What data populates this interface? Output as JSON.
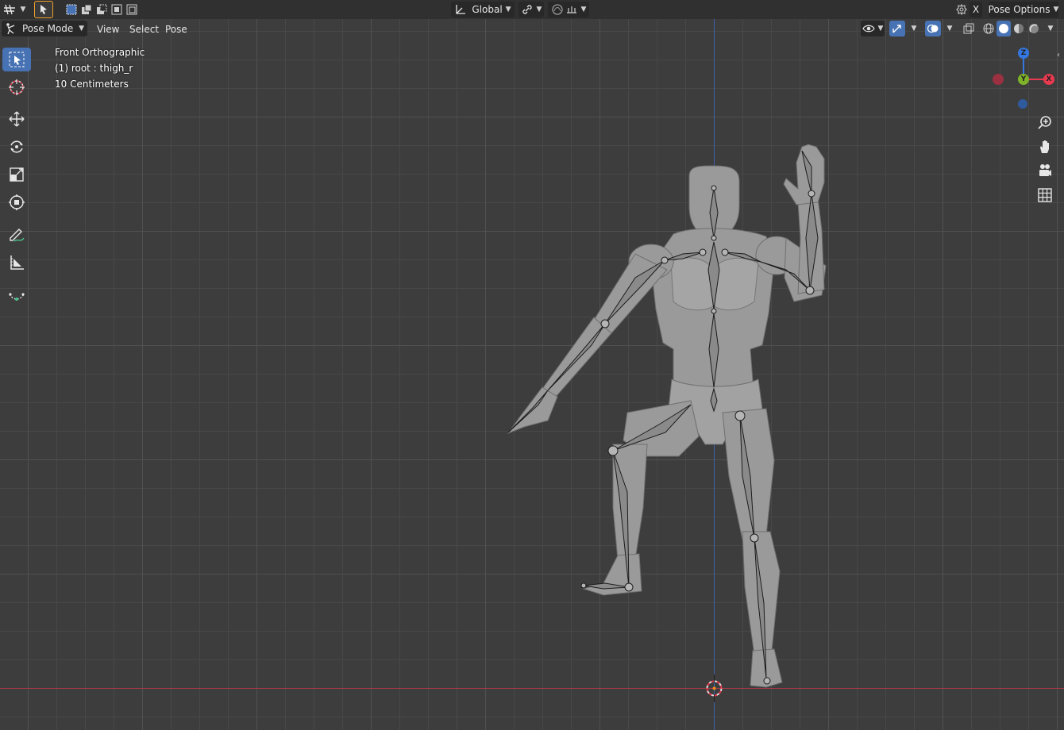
{
  "topbar": {
    "editor_type_icon": "grid-editor-icon",
    "transform_orientation": "Global",
    "close_label": "X",
    "pose_options_label": "Pose Options"
  },
  "header": {
    "mode": "Pose Mode",
    "menus": [
      "View",
      "Select",
      "Pose"
    ]
  },
  "viewport": {
    "view_name": "Front Orthographic",
    "active_object": "(1) root : thigh_r",
    "grid_scale": "10 Centimeters",
    "colors": {
      "background": "#3d3d3d",
      "grid_line": "#494949",
      "x_axis": "#b03a46",
      "z_axis": "#3d63a8",
      "accent": "#4772b3"
    }
  },
  "gizmo": {
    "z_label": "Z",
    "y_label": "Y",
    "x_label": "X",
    "colors": {
      "x": "#e83a4f",
      "y": "#7eb329",
      "z": "#3477e0"
    }
  },
  "toolbar": {
    "tools": [
      "select-box-icon",
      "cursor-icon",
      "move-icon",
      "rotate-icon",
      "scale-icon",
      "transform-icon",
      "annotate-icon",
      "measure-icon",
      "relax-pose-icon"
    ]
  },
  "navigation": {
    "buttons": [
      "zoom-icon",
      "pan-hand-icon",
      "camera-icon",
      "grid-view-icon"
    ]
  }
}
